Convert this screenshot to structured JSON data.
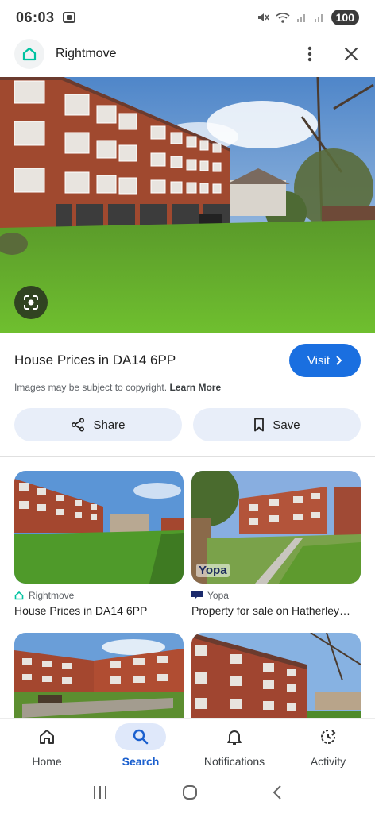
{
  "status": {
    "time": "06:03",
    "battery": "100"
  },
  "header": {
    "site_name": "Rightmove",
    "icon_logo": "house-icon",
    "icon_more": "more-vert-icon",
    "icon_close": "close-icon"
  },
  "result": {
    "title": "House Prices in DA14 6PP",
    "visit_label": "Visit",
    "copyright_text": "Images may be subject to copyright.",
    "learn_more": "Learn More",
    "share_label": "Share",
    "save_label": "Save"
  },
  "related": [
    {
      "source": "Rightmove",
      "title": "House Prices in DA14 6PP"
    },
    {
      "source": "Yopa",
      "title": "Property for sale on Hatherley…",
      "watermark": "Yopa"
    },
    {
      "source": "",
      "title": ""
    },
    {
      "source": "",
      "title": ""
    }
  ],
  "nav": {
    "items": [
      {
        "label": "Home",
        "icon": "home-icon"
      },
      {
        "label": "Search",
        "icon": "search-icon",
        "active": true
      },
      {
        "label": "Notifications",
        "icon": "bell-icon"
      },
      {
        "label": "Activity",
        "icon": "activity-icon"
      }
    ]
  },
  "colors": {
    "accent": "#1a6fe0",
    "chip_bg": "#e8eef9",
    "rightmove": "#00deb6"
  }
}
